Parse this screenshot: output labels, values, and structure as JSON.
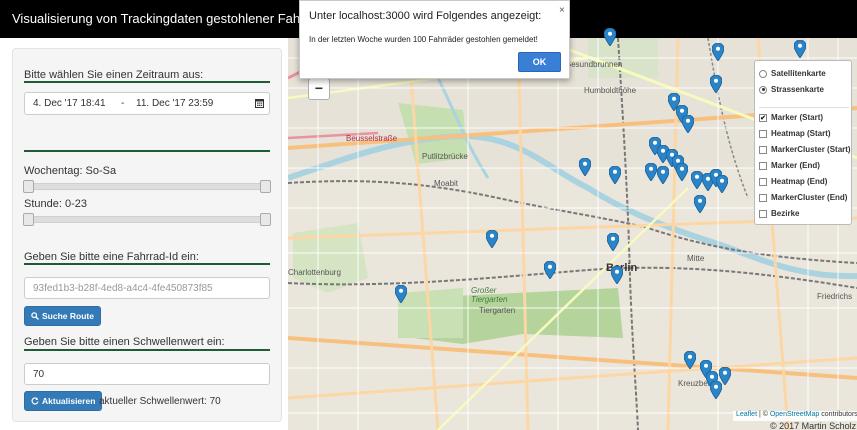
{
  "navbar": {
    "title": "Visualisierung von Trackingdaten gestohlener Fahrräder"
  },
  "sidebar": {
    "timerange_label": "Bitte wählen Sie einen Zeitraum aus:",
    "date_start": "4. Dec '17  18:41",
    "date_separator": "-",
    "date_end": "11. Dec '17  23:59",
    "weekday_label": "Wochentag: So-Sa",
    "hour_label": "Stunde: 0-23",
    "bike_id_label": "Geben Sie bitte eine Fahrrad-Id ein:",
    "bike_id_placeholder": "93fed1b3-b28f-4ed8-a4c4-4fe450873f85",
    "search_button": "Suche Route",
    "threshold_label": "Geben Sie bitte einen Schwellenwert ein:",
    "threshold_value": "70",
    "refresh_button": "Aktualisieren",
    "current_threshold": "aktueller Schwellenwert: 70"
  },
  "map": {
    "zoom_out": "−",
    "layers": {
      "base": [
        {
          "label": "Satellitenkarte",
          "selected": false
        },
        {
          "label": "Strassenkarte",
          "selected": true
        }
      ],
      "overlays": [
        {
          "label": "Marker (Start)",
          "checked": true
        },
        {
          "label": "Heatmap (Start)",
          "checked": false
        },
        {
          "label": "MarkerCluster (Start)",
          "checked": false
        },
        {
          "label": "Marker (End)",
          "checked": false
        },
        {
          "label": "Heatmap (End)",
          "checked": false
        },
        {
          "label": "MarkerCluster (End)",
          "checked": false
        },
        {
          "label": "Bezirke",
          "checked": false
        }
      ]
    },
    "places": [
      "Gesundbrunnen",
      "Humboldthöhe",
      "Beusselstraße",
      "Putlitzbrücke",
      "Moabit",
      "Charlottenburg",
      "Großer Tiergarten",
      "Tiergarten",
      "Berlin",
      "Mitte",
      "Friedrichs",
      "Kreuzberg"
    ],
    "attribution": {
      "leaflet": "Leaflet",
      "separator": " | © ",
      "osm": "OpenStreetMap",
      "contributors": " contributors"
    },
    "copyright": "© 2017 Martin Scholz",
    "marker_color": "#2a84c8"
  },
  "dialog": {
    "title": "Unter localhost:3000 wird Folgendes angezeigt:",
    "close": "×",
    "message": "In der letzten Woche wurden   100  Fahrräder gestohlen gemeldet!",
    "ok": "OK"
  }
}
